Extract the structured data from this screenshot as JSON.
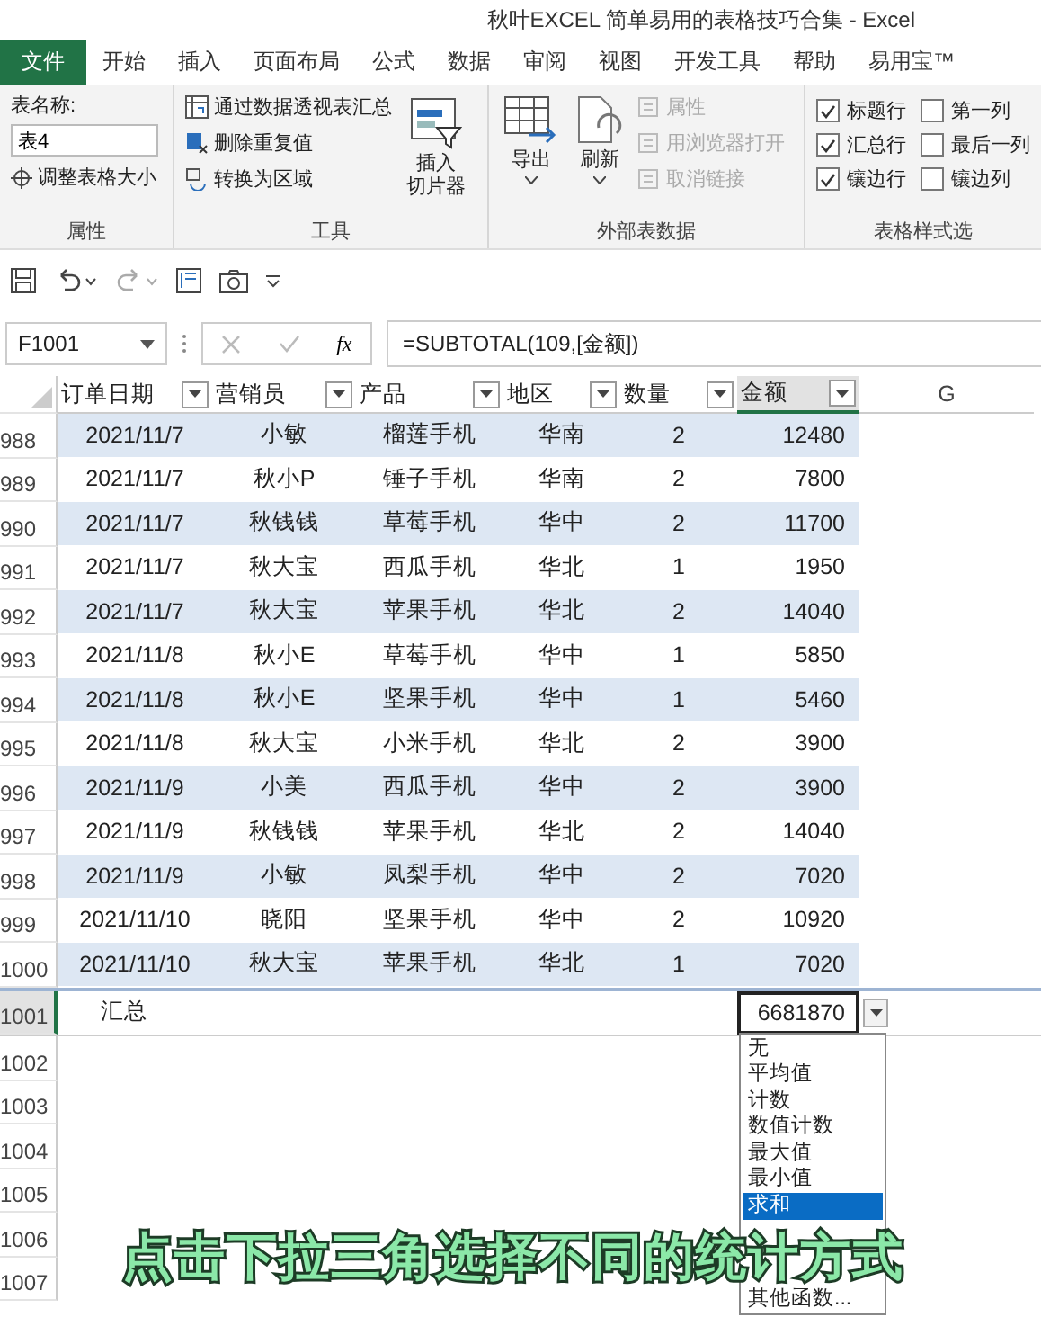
{
  "window": {
    "title": "秋叶EXCEL 简单易用的表格技巧合集  -  Excel"
  },
  "ribbon_tabs": [
    {
      "label": "文件",
      "selected": true
    },
    {
      "label": "开始",
      "selected": false
    },
    {
      "label": "插入",
      "selected": false
    },
    {
      "label": "页面布局",
      "selected": false
    },
    {
      "label": "公式",
      "selected": false
    },
    {
      "label": "数据",
      "selected": false
    },
    {
      "label": "审阅",
      "selected": false
    },
    {
      "label": "视图",
      "selected": false
    },
    {
      "label": "开发工具",
      "selected": false
    },
    {
      "label": "帮助",
      "selected": false
    },
    {
      "label": "易用宝™",
      "selected": false
    }
  ],
  "ribbon": {
    "properties": {
      "name_label": "表名称:",
      "name_value": "表4",
      "resize": "调整表格大小",
      "group": "属性"
    },
    "tools": {
      "items": [
        {
          "label": "通过数据透视表汇总"
        },
        {
          "label": "删除重复值"
        },
        {
          "label": "转换为区域"
        }
      ],
      "slicer_lines": [
        "插入",
        "切片器"
      ],
      "group": "工具"
    },
    "external": {
      "big": [
        {
          "label": "导出"
        },
        {
          "label": "刷新"
        }
      ],
      "small": [
        {
          "label": "属性",
          "disabled": true
        },
        {
          "label": "用浏览器打开",
          "disabled": true
        },
        {
          "label": "取消链接",
          "disabled": true
        }
      ],
      "group": "外部表数据"
    },
    "style_options": {
      "checkboxes": [
        {
          "label": "标题行",
          "checked": true
        },
        {
          "label": "第一列",
          "checked": false
        },
        {
          "label": "汇总行",
          "checked": true
        },
        {
          "label": "最后一列",
          "checked": false
        },
        {
          "label": "镶边行",
          "checked": true
        },
        {
          "label": "镶边列",
          "checked": false
        }
      ],
      "group": "表格样式选"
    }
  },
  "formula_bar": {
    "name_box": "F1001",
    "fx": "fx",
    "formula": "=SUBTOTAL(109,[金额])"
  },
  "columns": [
    {
      "label": "订单日期",
      "filter": true
    },
    {
      "label": "营销员",
      "filter": true
    },
    {
      "label": "产品",
      "filter": true
    },
    {
      "label": "地区",
      "filter": true
    },
    {
      "label": "数量",
      "filter": true
    },
    {
      "label": "金额",
      "filter": true,
      "selected": true
    },
    {
      "label": "G",
      "filter": false
    }
  ],
  "rows": [
    {
      "num": "988",
      "cells": [
        "2021/11/7",
        "小敏",
        "榴莲手机",
        "华南",
        "2",
        "12480"
      ]
    },
    {
      "num": "989",
      "cells": [
        "2021/11/7",
        "秋小P",
        "锤子手机",
        "华南",
        "2",
        "7800"
      ]
    },
    {
      "num": "990",
      "cells": [
        "2021/11/7",
        "秋钱钱",
        "草莓手机",
        "华中",
        "2",
        "11700"
      ]
    },
    {
      "num": "991",
      "cells": [
        "2021/11/7",
        "秋大宝",
        "西瓜手机",
        "华北",
        "1",
        "1950"
      ]
    },
    {
      "num": "992",
      "cells": [
        "2021/11/7",
        "秋大宝",
        "苹果手机",
        "华北",
        "2",
        "14040"
      ]
    },
    {
      "num": "993",
      "cells": [
        "2021/11/8",
        "秋小E",
        "草莓手机",
        "华中",
        "1",
        "5850"
      ]
    },
    {
      "num": "994",
      "cells": [
        "2021/11/8",
        "秋小E",
        "坚果手机",
        "华中",
        "1",
        "5460"
      ]
    },
    {
      "num": "995",
      "cells": [
        "2021/11/8",
        "秋大宝",
        "小米手机",
        "华北",
        "2",
        "3900"
      ]
    },
    {
      "num": "996",
      "cells": [
        "2021/11/9",
        "小美",
        "西瓜手机",
        "华中",
        "2",
        "3900"
      ]
    },
    {
      "num": "997",
      "cells": [
        "2021/11/9",
        "秋钱钱",
        "苹果手机",
        "华北",
        "2",
        "14040"
      ]
    },
    {
      "num": "998",
      "cells": [
        "2021/11/9",
        "小敏",
        "凤梨手机",
        "华中",
        "2",
        "7020"
      ]
    },
    {
      "num": "999",
      "cells": [
        "2021/11/10",
        "晓阳",
        "坚果手机",
        "华中",
        "2",
        "10920"
      ]
    },
    {
      "num": "1000",
      "cells": [
        "2021/11/10",
        "秋大宝",
        "苹果手机",
        "华北",
        "1",
        "7020"
      ]
    }
  ],
  "total_row": {
    "num": "1001",
    "label": "汇总",
    "value": "6681870"
  },
  "empty_rows": [
    "1002",
    "1003",
    "1004",
    "1005",
    "1006",
    "1007"
  ],
  "total_menu": [
    {
      "label": "无",
      "selected": false
    },
    {
      "label": "平均值",
      "selected": false
    },
    {
      "label": "计数",
      "selected": false
    },
    {
      "label": "数值计数",
      "selected": false
    },
    {
      "label": "最大值",
      "selected": false
    },
    {
      "label": "最小值",
      "selected": false
    },
    {
      "label": "求和",
      "selected": true
    },
    {
      "label": "其他函数...",
      "selected": false
    }
  ],
  "subtitle": "点击下拉三角选择不同的统计方式"
}
